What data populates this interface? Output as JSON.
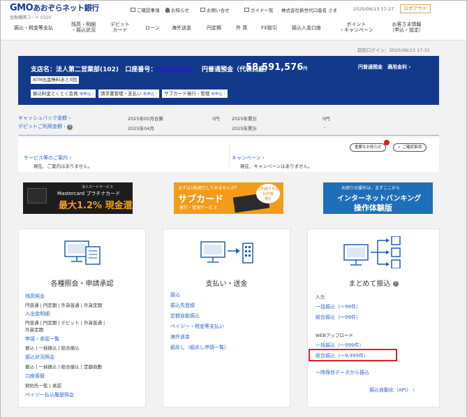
{
  "header": {
    "logo_gmo": "GMO",
    "logo_bank": "あおぞらネット銀行",
    "bank_code": "金融機関コード 0310",
    "links": [
      "ご確認事項",
      "お知らせ",
      "お問い合せ",
      "ガイド一覧"
    ],
    "company": "株式会社新世代口座名 さま",
    "datetime": "2025/06/13 17:27",
    "logout": "ログアウト",
    "nav": [
      "振込・税金等支払",
      "残高・明細\n・振込状況",
      "デビット\nカード",
      "ローン",
      "海外送金",
      "円定期",
      "外 貨",
      "FX取引",
      "振込入金口座",
      "ポイント\n・キャンペーン",
      "お客さま情報\n（申込・設定）"
    ]
  },
  "last_login": "前回ログイン：2025/06/13 17:31",
  "account": {
    "branch": "支店名：法人第二営業部(102)",
    "acct_label": "口座番号：",
    "type": "円普通預金（代表口座）",
    "balance": "58,591,576",
    "yen": "円",
    "right": "円普通預金　適用金利 ›",
    "atm": "ATM出金無料あと0回",
    "pills": [
      {
        "text": "振込料金とくとく会員",
        "tag": "未申込 ›"
      },
      {
        "text": "請求書管理・支払い",
        "tag": "未申込 ›"
      },
      {
        "text": "サブカード発行・管理",
        "tag": "未申込 ›"
      }
    ]
  },
  "cashback": {
    "link1": "キャッシュバック金額 ›",
    "link2": "デビットご利用金額 ›",
    "row1_month": "2025年05月合算",
    "row1_value": "0円",
    "row1_total_label": "2025年累計",
    "row1_total": "0円",
    "row2_month": "2025年04月",
    "row2_total_label": "2025年累計",
    "row2_total": "-"
  },
  "service": {
    "link1": "サービス等のご案内 ›",
    "text1": "現在、ご案内はありません。",
    "link2": "キャンペーン ›",
    "text2": "現在、キャンペーンはありません。",
    "btn1": "重要なお知らせ",
    "btn2": "ご確認事項"
  },
  "banners": {
    "b1_t1": "法人カードサービス",
    "b1_t2": "Mastercard プラチナカード",
    "b1_t3": "最大1.2% 現金還元",
    "b2_t1": "まずは1枚発行してみませんか？",
    "b2_t2": "サブカード",
    "b2_t3": "発行・管理サービス",
    "b2_badge": "ご利用できる\n10万枚\n発行",
    "b3_t1": "お困りの操作は、まずここから",
    "b3_t2": "インターネットバンキング",
    "b3_t3": "操作体験版"
  },
  "panel1": {
    "title": "各種照会・申請承認",
    "sections": [
      {
        "link": "残高照会",
        "items": "円普通 | 円定期 | 外貨普通 | 外貨定期"
      },
      {
        "link": "入出金明細",
        "items": "円普通 | 円定期 | デビット | 外貨普通 |",
        "items2": "外貨定期"
      },
      {
        "link": "申請・承認一覧",
        "items": "振込 | 一括振込 | 総合振込"
      },
      {
        "link": "振込状況照会",
        "items": "振込 | 一括振込 | 総合振込 | 定額自動"
      },
      {
        "link": "口座振替",
        "items": "契約先一覧 | 承認"
      },
      {
        "link": "ペイジー払込履歴照会"
      }
    ]
  },
  "panel2": {
    "title": "支払い・送金",
    "links": [
      "振込",
      "振込先登録",
      "定額自動振込",
      "ペイジー・税金等支払い",
      "海外送金",
      "組戻し（組戻し申請一覧）"
    ]
  },
  "panel3": {
    "title": "まとめて振込",
    "input_label": "入力",
    "input_links": [
      "一括振込（〜99件）",
      "総合振込（〜99件）"
    ],
    "web_label": "WEBアップロード",
    "web_links": [
      "一括振込（〜999件）",
      "総合振込（〜9,999件）"
    ],
    "temp_link": "一時保存データから振込",
    "api_link": "振込自動化（API） ›"
  }
}
